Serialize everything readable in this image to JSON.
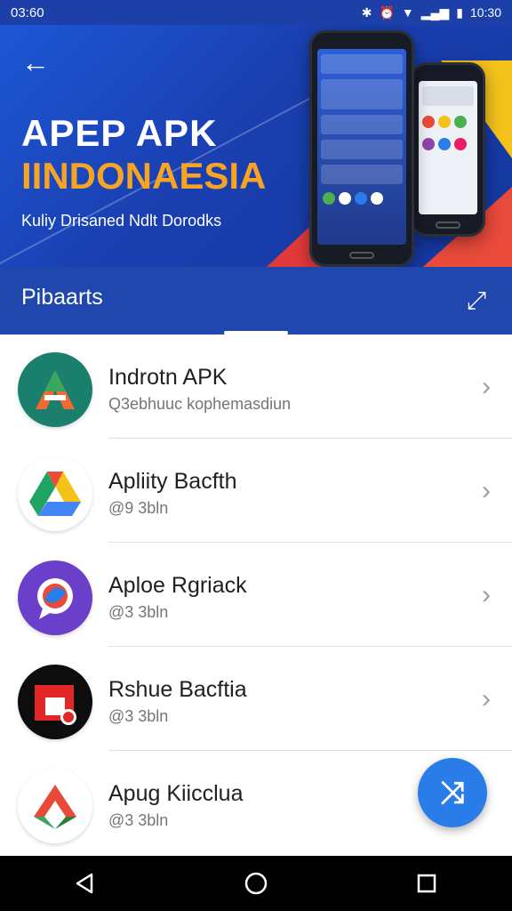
{
  "status": {
    "time_left": "03:60",
    "time_right": "10:30",
    "icons": [
      "bluetooth-icon",
      "alarm-icon",
      "wifi-icon",
      "signal-icon",
      "battery-icon"
    ]
  },
  "banner": {
    "title": "APEP APK",
    "subtitle": "IINDONAESIA",
    "tagline": "Kuliy Drisaned Ndlt Dorodks",
    "colors": {
      "background": "#1d57d6",
      "accent_orange": "#f7a424",
      "red": "#e23a3a",
      "yellow": "#f5c21b"
    }
  },
  "section": {
    "title": "Pibaarts"
  },
  "list": {
    "items": [
      {
        "title": "Indrotn APK",
        "subtitle": "Q3ebhuuc kophemasdiun",
        "icon": "a-logo-icon",
        "chevron": "›"
      },
      {
        "title": "Apliity Bacfth",
        "subtitle": "@9 3bln",
        "icon": "drive-logo-icon",
        "chevron": "›"
      },
      {
        "title": "Aploe Rgriack",
        "subtitle": "@3 3bln",
        "icon": "chat-logo-icon",
        "chevron": "›"
      },
      {
        "title": "Rshue Bacftia",
        "subtitle": "@3 3bln",
        "icon": "red-square-logo-icon",
        "chevron": "›"
      },
      {
        "title": "Apug Kiicclua",
        "subtitle": "@3 3bln",
        "icon": "arrow-logo-icon",
        "chevron": ""
      }
    ]
  },
  "fab": {
    "icon": "shuffle-icon",
    "glyph": "⤨"
  },
  "nav": {
    "back": "◁",
    "home": "◯",
    "recents": "▢"
  }
}
